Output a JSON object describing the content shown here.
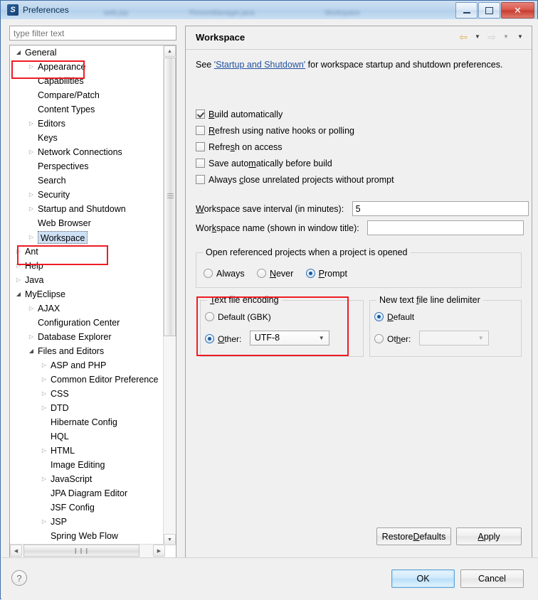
{
  "window": {
    "title": "Preferences",
    "app_icon": "eclipse-icon",
    "minimize_label": "–",
    "maximize_label": "□",
    "close_label": "✕",
    "ghost_tabs": [
      "web.jsp",
      "PersonManager.java",
      "Workspace"
    ]
  },
  "sidebar": {
    "filter_placeholder": "type filter text",
    "filter_value": "",
    "scroll_thumb_glyph": "≡",
    "hscroll_thumb_glyph": "❙❙❙",
    "up_arrow": "▲",
    "down_arrow": "▼",
    "left_arrow": "◀",
    "right_arrow": "▶",
    "items": [
      {
        "label": "General",
        "indent": 0,
        "arrow": "open",
        "selected": false
      },
      {
        "label": "Appearance",
        "indent": 1,
        "arrow": "closed",
        "selected": false
      },
      {
        "label": "Capabilities",
        "indent": 1,
        "arrow": "none",
        "selected": false
      },
      {
        "label": "Compare/Patch",
        "indent": 1,
        "arrow": "none",
        "selected": false
      },
      {
        "label": "Content Types",
        "indent": 1,
        "arrow": "none",
        "selected": false
      },
      {
        "label": "Editors",
        "indent": 1,
        "arrow": "closed",
        "selected": false
      },
      {
        "label": "Keys",
        "indent": 1,
        "arrow": "none",
        "selected": false
      },
      {
        "label": "Network Connections",
        "indent": 1,
        "arrow": "closed",
        "selected": false
      },
      {
        "label": "Perspectives",
        "indent": 1,
        "arrow": "none",
        "selected": false
      },
      {
        "label": "Search",
        "indent": 1,
        "arrow": "none",
        "selected": false
      },
      {
        "label": "Security",
        "indent": 1,
        "arrow": "closed",
        "selected": false
      },
      {
        "label": "Startup and Shutdown",
        "indent": 1,
        "arrow": "closed",
        "selected": false
      },
      {
        "label": "Web Browser",
        "indent": 1,
        "arrow": "none",
        "selected": false
      },
      {
        "label": "Workspace",
        "indent": 1,
        "arrow": "closed",
        "selected": true
      },
      {
        "label": "Ant",
        "indent": 0,
        "arrow": "closed",
        "selected": false
      },
      {
        "label": "Help",
        "indent": 0,
        "arrow": "closed",
        "selected": false
      },
      {
        "label": "Java",
        "indent": 0,
        "arrow": "closed",
        "selected": false
      },
      {
        "label": "MyEclipse",
        "indent": 0,
        "arrow": "open",
        "selected": false
      },
      {
        "label": "AJAX",
        "indent": 1,
        "arrow": "closed",
        "selected": false
      },
      {
        "label": "Configuration Center",
        "indent": 1,
        "arrow": "none",
        "selected": false
      },
      {
        "label": "Database Explorer",
        "indent": 1,
        "arrow": "closed",
        "selected": false
      },
      {
        "label": "Files and Editors",
        "indent": 1,
        "arrow": "open",
        "selected": false
      },
      {
        "label": "ASP and PHP",
        "indent": 2,
        "arrow": "closed",
        "selected": false
      },
      {
        "label": "Common Editor Preference",
        "indent": 2,
        "arrow": "closed",
        "selected": false
      },
      {
        "label": "CSS",
        "indent": 2,
        "arrow": "closed",
        "selected": false
      },
      {
        "label": "DTD",
        "indent": 2,
        "arrow": "closed",
        "selected": false
      },
      {
        "label": "Hibernate Config",
        "indent": 2,
        "arrow": "none",
        "selected": false
      },
      {
        "label": "HQL",
        "indent": 2,
        "arrow": "none",
        "selected": false
      },
      {
        "label": "HTML",
        "indent": 2,
        "arrow": "closed",
        "selected": false
      },
      {
        "label": "Image Editing",
        "indent": 2,
        "arrow": "none",
        "selected": false
      },
      {
        "label": "JavaScript",
        "indent": 2,
        "arrow": "closed",
        "selected": false
      },
      {
        "label": "JPA Diagram Editor",
        "indent": 2,
        "arrow": "none",
        "selected": false
      },
      {
        "label": "JSF Config",
        "indent": 2,
        "arrow": "none",
        "selected": false
      },
      {
        "label": "JSP",
        "indent": 2,
        "arrow": "closed",
        "selected": false
      },
      {
        "label": "Spring Web Flow",
        "indent": 2,
        "arrow": "none",
        "selected": false
      }
    ]
  },
  "page": {
    "title": "Workspace",
    "nav": {
      "back_icon": "back-arrow-icon",
      "back_menu_icon": "chevron-down-icon",
      "forward_icon": "forward-arrow-icon",
      "forward_menu_icon": "chevron-down-icon",
      "menu_icon": "chevron-down-icon",
      "caret_glyph": "▼",
      "back_glyph": "⇦",
      "forward_glyph": "⇨"
    },
    "description": {
      "prefix": "See ",
      "link": "'Startup and Shutdown'",
      "suffix": " for workspace startup and shutdown preferences."
    },
    "checkboxes": [
      {
        "label": "Build automatically",
        "mnemonic": "B",
        "checked": true
      },
      {
        "label": "Refresh using native hooks or polling",
        "mnemonic": "R",
        "checked": false
      },
      {
        "label": "Refresh on access",
        "mnemonic": "s",
        "checked": false
      },
      {
        "label": "Save automatically before build",
        "mnemonic": "m",
        "checked": false
      },
      {
        "label": "Always close unrelated projects without prompt",
        "mnemonic": "c",
        "checked": false
      }
    ],
    "fields": [
      {
        "label": "Workspace save interval (in minutes):",
        "value": "5"
      },
      {
        "label": "Workspace name (shown in window title):",
        "value": ""
      }
    ],
    "open_referenced_group": {
      "caption": "Open referenced projects when a project is opened",
      "options": [
        {
          "label": "Always",
          "selected": false
        },
        {
          "label": "Never",
          "selected": false
        },
        {
          "label": "Prompt",
          "selected": true
        }
      ]
    },
    "text_file_encoding_group": {
      "caption": "Text file encoding",
      "default_label": "Default (GBK)",
      "default_selected": false,
      "other_label": "Other:",
      "other_selected": true,
      "other_value": "UTF-8",
      "combo_arrow": "▼"
    },
    "line_delimiter_group": {
      "caption": "New text file line delimiter",
      "default_label": "Default",
      "default_selected": true,
      "other_label": "Other:",
      "other_selected": false,
      "other_value": "",
      "combo_arrow": "▼"
    },
    "restore_defaults_label": "Restore Defaults",
    "apply_label": "Apply"
  },
  "dialog_footer": {
    "help_glyph": "?",
    "ok_label": "OK",
    "cancel_label": "Cancel"
  },
  "colors": {
    "accent_red": "#ee1c25",
    "link_blue": "#2352a0",
    "selection_blue": "#cde0f5",
    "titlebar_blue": "#bcd6ee"
  }
}
